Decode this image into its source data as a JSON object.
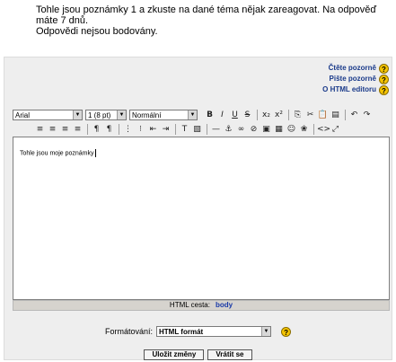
{
  "intro": {
    "line1": "Tohle jsou poznámky 1 a zkuste na dané téma nějak zareagovat. Na odpověď máte 7 dnů.",
    "line2": "Odpovědi nejsou bodovány."
  },
  "help_links": [
    {
      "label": "Čtěte pozorně",
      "icon": "help-icon"
    },
    {
      "label": "Pište pozorně",
      "icon": "help-icon"
    },
    {
      "label": "O HTML editoru",
      "icon": "help-icon"
    }
  ],
  "toolbar": {
    "font": "Arial",
    "size": "1 (8 pt)",
    "style": "Normální",
    "row1_buttons": [
      {
        "glyph": "B",
        "name": "bold"
      },
      {
        "glyph": "I",
        "name": "italic"
      },
      {
        "glyph": "U",
        "name": "underline"
      },
      {
        "glyph": "S",
        "name": "strikethrough"
      },
      {
        "glyph": "x₂",
        "name": "subscript"
      },
      {
        "glyph": "x²",
        "name": "superscript"
      },
      {
        "glyph": "⎘",
        "name": "copy"
      },
      {
        "glyph": "✂",
        "name": "cut"
      },
      {
        "glyph": "📋",
        "name": "paste"
      },
      {
        "glyph": "▤",
        "name": "clean-word"
      },
      {
        "glyph": "↶",
        "name": "undo"
      },
      {
        "glyph": "↷",
        "name": "redo"
      }
    ],
    "row2_buttons": [
      {
        "glyph": "≡",
        "name": "align-left"
      },
      {
        "glyph": "≡",
        "name": "align-center"
      },
      {
        "glyph": "≡",
        "name": "align-right"
      },
      {
        "glyph": "≡",
        "name": "justify"
      },
      {
        "glyph": "¶",
        "name": "ltr"
      },
      {
        "glyph": "¶",
        "name": "rtl"
      },
      {
        "glyph": "⋮",
        "name": "ordered-list"
      },
      {
        "glyph": "⁝",
        "name": "unordered-list"
      },
      {
        "glyph": "⇤",
        "name": "outdent"
      },
      {
        "glyph": "⇥",
        "name": "indent"
      },
      {
        "glyph": "T",
        "name": "text-color"
      },
      {
        "glyph": "▧",
        "name": "bg-color"
      },
      {
        "glyph": "—",
        "name": "horizontal-rule"
      },
      {
        "glyph": "⚓",
        "name": "anchor"
      },
      {
        "glyph": "∞",
        "name": "link"
      },
      {
        "glyph": "⊘",
        "name": "unlink"
      },
      {
        "glyph": "▣",
        "name": "image"
      },
      {
        "glyph": "▦",
        "name": "table"
      },
      {
        "glyph": "☺",
        "name": "smiley"
      },
      {
        "glyph": "❀",
        "name": "special-char"
      },
      {
        "glyph": "<>",
        "name": "html-source"
      },
      {
        "glyph": "⤢",
        "name": "fullscreen"
      }
    ]
  },
  "editor": {
    "content": "Tohle jsou moje poznámky"
  },
  "path": {
    "label": "HTML cesta:",
    "value": "body"
  },
  "format": {
    "label": "Formátování:",
    "value": "HTML formát"
  },
  "buttons": {
    "save": "Uložit změny",
    "revert": "Vrátit se"
  }
}
